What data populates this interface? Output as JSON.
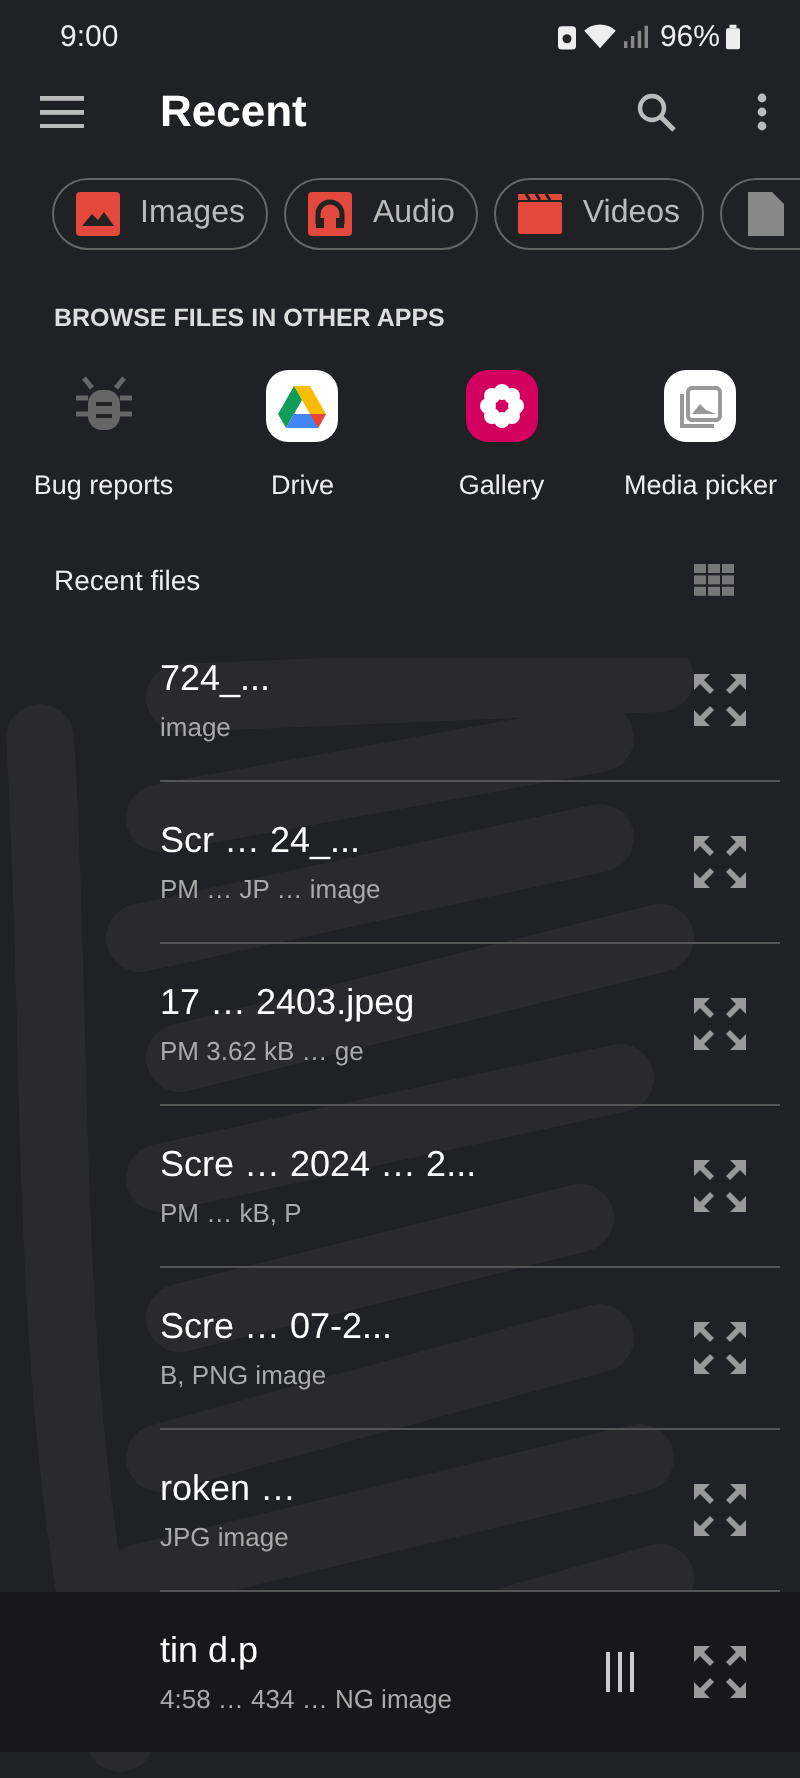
{
  "status_bar": {
    "time": "9:00",
    "battery": "96%"
  },
  "toolbar": {
    "title": "Recent"
  },
  "chips": [
    {
      "kind": "images",
      "label": "Images"
    },
    {
      "kind": "audio",
      "label": "Audio"
    },
    {
      "kind": "videos",
      "label": "Videos"
    },
    {
      "kind": "documents"
    }
  ],
  "apps_section": {
    "heading": "BROWSE FILES IN OTHER APPS",
    "apps": [
      {
        "kind": "bug",
        "label": "Bug reports"
      },
      {
        "kind": "drive",
        "label": "Drive"
      },
      {
        "kind": "gallery",
        "label": "Gallery"
      },
      {
        "kind": "media",
        "label": "Media picker"
      }
    ]
  },
  "recent_files": {
    "heading": "Recent files",
    "files": [
      {
        "title": "724_...",
        "subtitle": "image"
      },
      {
        "title": "Scr … 24_...",
        "subtitle": "PM … JP … image"
      },
      {
        "title": "17 … 2403.jpeg",
        "subtitle": "PM 3.62 kB … ge"
      },
      {
        "title": "Scre … 2024 … 2...",
        "subtitle": "PM … kB, P"
      },
      {
        "title": "Scre … 07-2...",
        "subtitle": "B, PNG image"
      },
      {
        "title": "roken …",
        "subtitle": "JPG image"
      },
      {
        "title": "tin d.p",
        "subtitle": "4:58 … 434 … NG image"
      }
    ]
  }
}
